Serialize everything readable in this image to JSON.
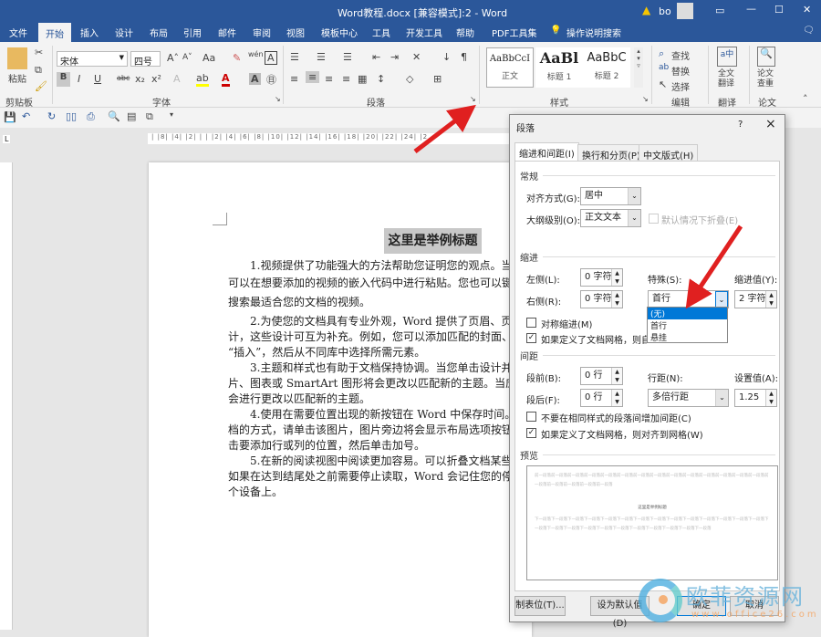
{
  "window": {
    "title": "Word教程.docx [兼容模式]:2  -  Word",
    "user": "bo",
    "warning_icon": "warning-icon",
    "controls": [
      "ribbon-display-icon",
      "minimize-icon",
      "maximize-icon",
      "close-icon"
    ]
  },
  "tabs": [
    {
      "label": "文件"
    },
    {
      "label": "开始",
      "active": true
    },
    {
      "label": "插入"
    },
    {
      "label": "设计"
    },
    {
      "label": "布局"
    },
    {
      "label": "引用"
    },
    {
      "label": "邮件"
    },
    {
      "label": "审阅"
    },
    {
      "label": "视图"
    },
    {
      "label": "模板中心"
    },
    {
      "label": "工具"
    },
    {
      "label": "开发工具"
    },
    {
      "label": "帮助"
    },
    {
      "label": "PDF工具集"
    }
  ],
  "tell_me": "操作说明搜索",
  "ribbon": {
    "clipboard": {
      "paste": "粘贴",
      "group": "剪贴板"
    },
    "font": {
      "name": "宋体",
      "size": "四号",
      "group": "字体",
      "buttons": [
        "B",
        "I",
        "U",
        "abc",
        "x₂",
        "x²"
      ]
    },
    "paragraph": {
      "group": "段落"
    },
    "styles": {
      "group": "样式",
      "items": [
        {
          "preview": "AaBbCcI",
          "label": "正文"
        },
        {
          "preview": "AaBl",
          "label": "标题 1"
        },
        {
          "preview": "AaBbC",
          "label": "标题 2"
        }
      ]
    },
    "editing": {
      "group": "编辑",
      "find": "查找",
      "replace": "替换",
      "select": "选择"
    },
    "translate": {
      "button": "全文翻译",
      "group": "翻译"
    },
    "paper": {
      "button": "论文查重",
      "group": "论文"
    }
  },
  "ruler": "| |8| |4| |2| |  | |2| |4| |6| |8| |10| |12| |14| |16| |18| |20| |22| |24| |2",
  "document": {
    "title": "这里是举例标题",
    "lines": [
      "　　1.视频提供了功能强大的方法帮助您证明您的观点。当",
      "可以在想要添加的视频的嵌入代码中进行粘贴。您也可以键入",
      "搜索最适合您的文档的视频。",
      "　　2.为使您的文档具有专业外观，Word 提供了页眉、页脚",
      "计，这些设计可互为补充。例如，您可以添加匹配的封面、页",
      "“插入”，然后从不同库中选择所需元素。",
      "　　3.主题和样式也有助于文档保持协调。当您单击设计并选",
      "片、图表或 SmartArt 图形将会更改以匹配新的主题。当应用",
      "会进行更改以匹配新的主题。",
      "　　4.使用在需要位置出现的新按钮在 Word 中保存时间。若",
      "档的方式，请单击该图片，图片旁边将会显示布局选项按钮。",
      "击要添加行或列的位置，然后单击加号。",
      "　　5.在新的阅读视图中阅读更加容易。可以折叠文档某些部",
      "如果在达到结尾处之前需要停止读取，Word 会记住您的停止",
      "个设备上。"
    ]
  },
  "dialog": {
    "title": "段落",
    "help": "?",
    "close": "×",
    "tabs": [
      "缩进和间距(I)",
      "换行和分页(P)",
      "中文版式(H)"
    ],
    "general": {
      "heading": "常规",
      "alignment_label": "对齐方式(G):",
      "alignment": "居中",
      "outline_label": "大纲级别(O):",
      "outline": "正文文本",
      "collapse_label": "默认情况下折叠(E)"
    },
    "indent": {
      "heading": "缩进",
      "left_label": "左侧(L):",
      "left": "0 字符",
      "right_label": "右侧(R):",
      "right": "0 字符",
      "special_label": "特殊(S):",
      "special": "首行",
      "by_label": "缩进值(Y):",
      "by": "2 字符",
      "special_options": [
        "(无)",
        "首行",
        "悬挂"
      ],
      "highlighted_option": "(无)",
      "mirror_label": "对称缩进(M)",
      "mirror": false,
      "grid_label": "如果定义了文档网格，则自动调整右缩进(D)",
      "grid": true
    },
    "spacing": {
      "heading": "间距",
      "before_label": "段前(B):",
      "before": "0 行",
      "after_label": "段后(F):",
      "after": "0 行",
      "line_label": "行距(N):",
      "line": "多倍行距",
      "at_label": "设置值(A):",
      "at": "1.25",
      "no_space_label": "不要在相同样式的段落间增加间距(C)",
      "no_space": false,
      "snap_label": "如果定义了文档网格，则对齐到网格(W)",
      "snap": true
    },
    "preview": {
      "heading": "预览",
      "prev_text": "前一段落前一段落前一段落前一段落前一段落前一段落前一段落前一段落前一段落前一段落前一段落前一段落前一段落前一段落前一段落前一段落前一段落前一段落前一段落",
      "sample": "这里是举例标题",
      "next_text": "下一段落下一段落下一段落下一段落下一段落下一段落下一段落下一段落下一段落下一段落下一段落下一段落下一段落下一段落下一段落下一段落下一段落下一段落下一段落下一段落下一段落下一段落下一段落下一段落下一段落"
    },
    "buttons": {
      "tabs": "制表位(T)...",
      "default": "设为默认值(D)",
      "ok": "确定",
      "cancel": "取消"
    }
  },
  "watermark": {
    "text": "欧菲资源网",
    "url": "www.office26.com"
  },
  "colors": {
    "brand": "#2b579a",
    "arrow": "#e02020",
    "highlight": "#0078d7"
  }
}
